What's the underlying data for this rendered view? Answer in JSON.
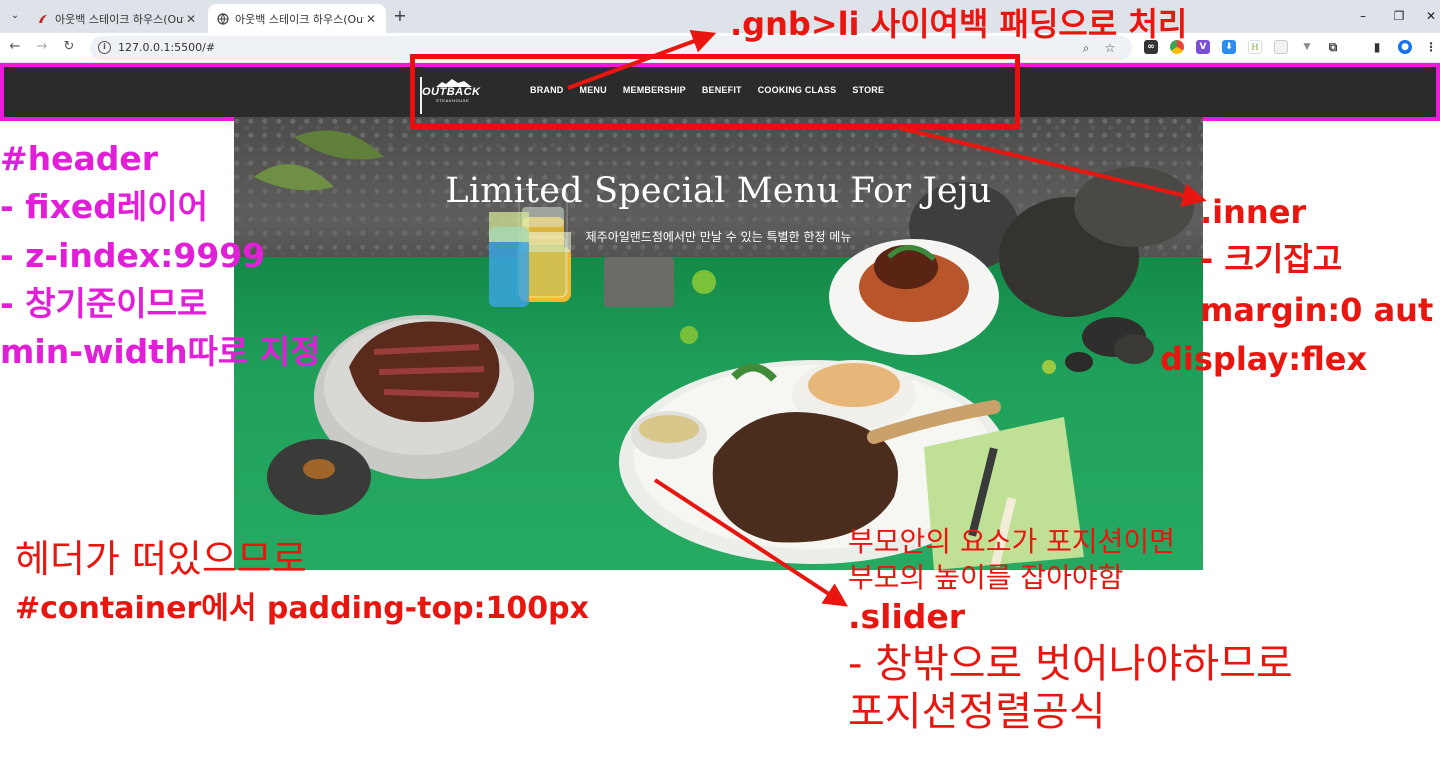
{
  "browser": {
    "tabs": [
      {
        "title": "아웃백 스테이크 하우스(Outba",
        "active": false
      },
      {
        "title": "아웃백 스테이크 하우스(Outba",
        "active": true
      }
    ],
    "new_tab": "+",
    "url": "127.0.0.1:5500/#",
    "window_controls": {
      "minimize": "–",
      "restore": "❐",
      "close": "✕"
    }
  },
  "site": {
    "logo_main": "OUTBACK",
    "logo_sub": "STEAKHOUSE",
    "gnb": [
      "BRAND",
      "MENU",
      "MEMBERSHIP",
      "BENEFIT",
      "COOKING CLASS",
      "STORE"
    ],
    "hero_title": "Limited Special Menu For Jeju",
    "hero_subtitle": "제주아일랜드점에서만 만날 수 있는 특별한 한정 메뉴"
  },
  "annotations": {
    "gnb_note": ".gnb>li 사이여백 패딩으로 처리",
    "header_title": "#header",
    "header_lines": [
      "- fixed레이어",
      "- z-index:9999",
      "- 창기준이므로",
      "min-width따로 지정"
    ],
    "inner_title": ".inner",
    "inner_lines": [
      "- 크기잡고",
      "margin:0 aut",
      "display:flex"
    ],
    "container_lines": [
      "헤더가 떠있으므로",
      "#container에서 padding-top:100px"
    ],
    "slider_note_lines": [
      "부모안의 요소가 포지션이면",
      "부모의 높이를 잡아야함"
    ],
    "slider_title": ".slider",
    "slider_lines": [
      "- 창밖으로 벗어나야하므로",
      "포지션정렬공식"
    ]
  },
  "colors": {
    "annotation_red": "#e8160f",
    "annotation_magenta": "#e21fd8",
    "header_bg": "#2c2b2b",
    "table_green": "#20a15b"
  }
}
